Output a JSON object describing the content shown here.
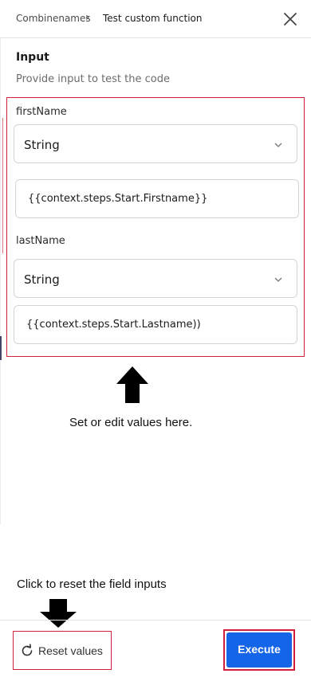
{
  "header": {
    "breadcrumb_parent": "Combinenames",
    "breadcrumb_separator": "›",
    "breadcrumb_current": "Test custom function",
    "close_icon": "close-icon"
  },
  "input_section": {
    "title": "Input",
    "subtitle": "Provide input to test the code"
  },
  "fields": [
    {
      "label": "firstName",
      "type": "String",
      "value": "{{context.steps.Start.Firstname}}"
    },
    {
      "label": "lastName",
      "type": "String",
      "value": "{{context.steps.Start.Lastname))"
    }
  ],
  "annotations": {
    "set_values_note": "Set or edit values here.",
    "reset_note": "Click to reset the field inputs",
    "highlight_color": "#d01f3c"
  },
  "footer": {
    "reset_label": "Reset values",
    "reset_icon": "refresh-icon",
    "execute_label": "Execute",
    "execute_color": "#1565e8"
  }
}
